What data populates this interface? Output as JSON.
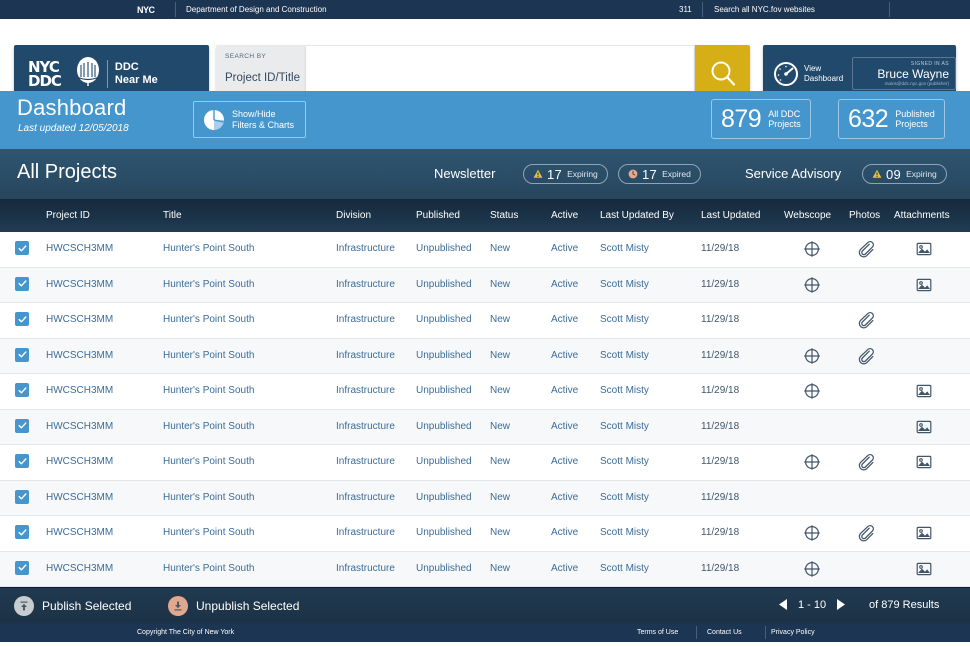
{
  "nyc_bar": {
    "logo": "NYC",
    "agency": "Department of Design and Construction",
    "phone": "311",
    "search_all": "Search all NYC.fov websites"
  },
  "header": {
    "brand_mark_line1": "NYC",
    "brand_mark_line2": "DDC",
    "brand_line1": "DDC",
    "brand_line2": "Near Me",
    "search_by_label": "SEARCH BY",
    "search_by_value": "Project ID/Title",
    "search_placeholder": "",
    "search_value": "",
    "search_icon": "search-icon",
    "view_dashboard_line1": "View",
    "view_dashboard_line2": "Dashboard",
    "signed_in_label": "SIGNED IN AS",
    "user_name": "Bruce Wayne",
    "user_email": "mains@ddc.nyc.gov (publisher)"
  },
  "dashboard": {
    "title": "Dashboard",
    "last_updated": "Last updated 12/05/2018",
    "showhide_line1": "Show/Hide",
    "showhide_line2": "Filters & Charts",
    "showhide_icon": "pie-chart-icon",
    "stats": [
      {
        "number": "879",
        "label_line1": "All DDC",
        "label_line2": "Projects"
      },
      {
        "number": "632",
        "label_line1": "Published",
        "label_line2": "Projects"
      }
    ]
  },
  "projects_bar": {
    "title": "All Projects",
    "newsletter_label": "Newsletter",
    "service_advisory_label": "Service Advisory",
    "pills": [
      {
        "icon": "warning-triangle-icon",
        "number": "17",
        "word": "Expiring",
        "color": "#e8c33a"
      },
      {
        "icon": "clock-icon",
        "number": "17",
        "word": "Expired",
        "color": "#e8a88c"
      },
      {
        "icon": "warning-triangle-icon",
        "number": "09",
        "word": "Expiring",
        "color": "#e8c33a"
      }
    ]
  },
  "table": {
    "columns": [
      "Project ID",
      "Title",
      "Division",
      "Published",
      "Status",
      "Active",
      "Last Updated By",
      "Last Updated",
      "Webscope",
      "Photos",
      "Attachments"
    ],
    "rows": [
      {
        "checked": true,
        "project_id": "HWCSCH3MM",
        "title": "Hunter's Point South",
        "division": "Infrastructure",
        "published": "Unpublished",
        "status": "New",
        "active": "Active",
        "updated_by": "Scott Misty",
        "updated": "11/29/18",
        "webscope": true,
        "photos": true,
        "attachments": true
      },
      {
        "checked": true,
        "project_id": "HWCSCH3MM",
        "title": "Hunter's Point South",
        "division": "Infrastructure",
        "published": "Unpublished",
        "status": "New",
        "active": "Active",
        "updated_by": "Scott Misty",
        "updated": "11/29/18",
        "webscope": true,
        "photos": false,
        "attachments": true
      },
      {
        "checked": true,
        "project_id": "HWCSCH3MM",
        "title": "Hunter's Point South",
        "division": "Infrastructure",
        "published": "Unpublished",
        "status": "New",
        "active": "Active",
        "updated_by": "Scott Misty",
        "updated": "11/29/18",
        "webscope": false,
        "photos": true,
        "attachments": false
      },
      {
        "checked": true,
        "project_id": "HWCSCH3MM",
        "title": "Hunter's Point South",
        "division": "Infrastructure",
        "published": "Unpublished",
        "status": "New",
        "active": "Active",
        "updated_by": "Scott Misty",
        "updated": "11/29/18",
        "webscope": true,
        "photos": true,
        "attachments": false
      },
      {
        "checked": true,
        "project_id": "HWCSCH3MM",
        "title": "Hunter's Point South",
        "division": "Infrastructure",
        "published": "Unpublished",
        "status": "New",
        "active": "Active",
        "updated_by": "Scott Misty",
        "updated": "11/29/18",
        "webscope": true,
        "photos": false,
        "attachments": true
      },
      {
        "checked": true,
        "project_id": "HWCSCH3MM",
        "title": "Hunter's Point South",
        "division": "Infrastructure",
        "published": "Unpublished",
        "status": "New",
        "active": "Active",
        "updated_by": "Scott Misty",
        "updated": "11/29/18",
        "webscope": false,
        "photos": false,
        "attachments": true
      },
      {
        "checked": true,
        "project_id": "HWCSCH3MM",
        "title": "Hunter's Point South",
        "division": "Infrastructure",
        "published": "Unpublished",
        "status": "New",
        "active": "Active",
        "updated_by": "Scott Misty",
        "updated": "11/29/18",
        "webscope": true,
        "photos": true,
        "attachments": true
      },
      {
        "checked": true,
        "project_id": "HWCSCH3MM",
        "title": "Hunter's Point South",
        "division": "Infrastructure",
        "published": "Unpublished",
        "status": "New",
        "active": "Active",
        "updated_by": "Scott Misty",
        "updated": "11/29/18",
        "webscope": false,
        "photos": false,
        "attachments": false
      },
      {
        "checked": true,
        "project_id": "HWCSCH3MM",
        "title": "Hunter's Point South",
        "division": "Infrastructure",
        "published": "Unpublished",
        "status": "New",
        "active": "Active",
        "updated_by": "Scott Misty",
        "updated": "11/29/18",
        "webscope": true,
        "photos": true,
        "attachments": true
      },
      {
        "checked": true,
        "project_id": "HWCSCH3MM",
        "title": "Hunter's Point South",
        "division": "Infrastructure",
        "published": "Unpublished",
        "status": "New",
        "active": "Active",
        "updated_by": "Scott Misty",
        "updated": "11/29/18",
        "webscope": true,
        "photos": false,
        "attachments": true
      }
    ]
  },
  "action_bar": {
    "publish_label": "Publish Selected",
    "publish_icon": "upload-arrow-icon",
    "unpublish_label": "Unpublish Selected",
    "unpublish_icon": "download-arrow-icon",
    "prev_icon": "prev-arrow-icon",
    "next_icon": "next-arrow-icon",
    "page_range": "1 - 10",
    "total_results": "of 879 Results"
  },
  "footer": {
    "copyright": "Copyright The City of New York",
    "links": [
      "Terms of Use",
      "Contact Us",
      "Privacy Policy"
    ]
  }
}
